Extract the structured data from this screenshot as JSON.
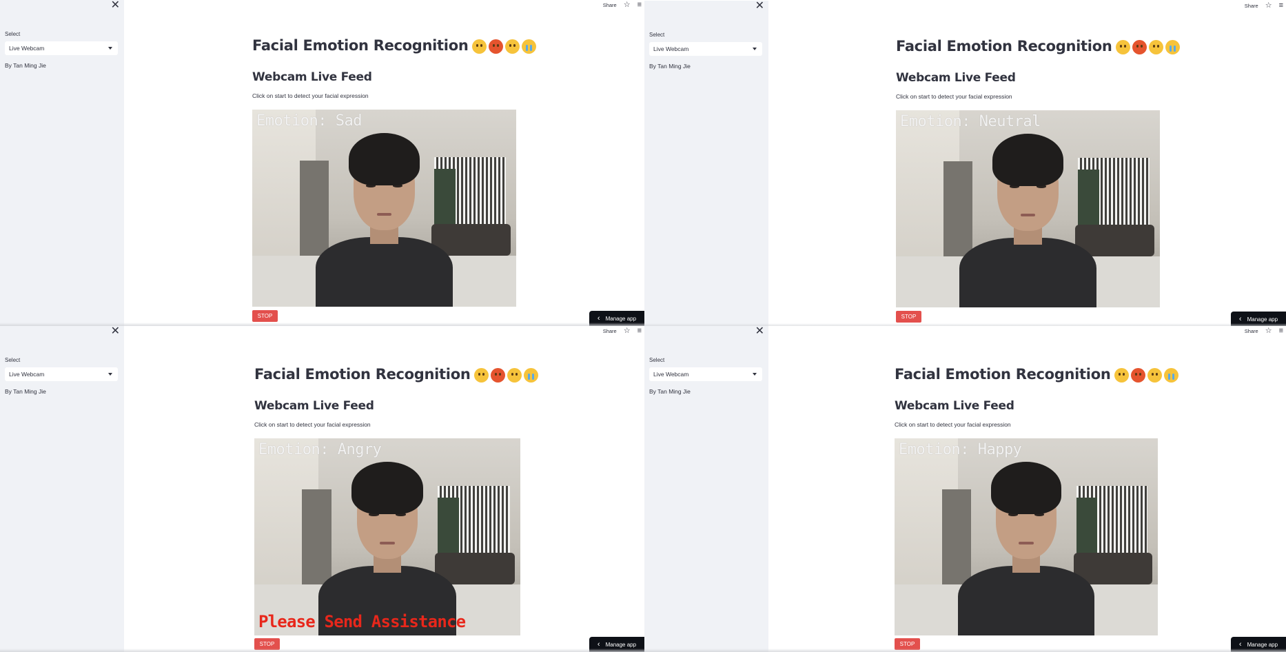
{
  "colors": {
    "sidebar_bg": "#f0f2f6",
    "text": "#31333f",
    "stop_button": "#e3504d",
    "manage_app_bg": "#0e1117",
    "alert_text": "#e8271b"
  },
  "panels": [
    {
      "sidebar": {
        "select_label": "Select",
        "select_value": "Live Webcam",
        "author": "By Tan Ming Jie",
        "close_icon": "✕"
      },
      "topbar": {
        "share_label": "Share",
        "star_icon": "☆",
        "menu_icon": "≡"
      },
      "title": "Facial Emotion Recognition",
      "title_emojis": [
        "happy-emoji",
        "angry-emoji",
        "neutral-emoji",
        "crying-emoji"
      ],
      "subheader": "Webcam Live Feed",
      "caption": "Click on start to detect your facial expression",
      "video": {
        "emotion_text": "Emotion: Sad",
        "alert_text": ""
      },
      "stop_button": "STOP",
      "manage_app": "Manage app"
    },
    {
      "sidebar": {
        "select_label": "Select",
        "select_value": "Live Webcam",
        "author": "By Tan Ming Jie",
        "close_icon": "✕"
      },
      "topbar": {
        "share_label": "Share",
        "star_icon": "☆",
        "menu_icon": "≡"
      },
      "title": "Facial Emotion Recognition",
      "title_emojis": [
        "happy-emoji",
        "angry-emoji",
        "neutral-emoji",
        "crying-emoji"
      ],
      "subheader": "Webcam Live Feed",
      "caption": "Click on start to detect your facial expression",
      "video": {
        "emotion_text": "Emotion: Neutral",
        "alert_text": ""
      },
      "stop_button": "STOP",
      "manage_app": "Manage app"
    },
    {
      "sidebar": {
        "select_label": "Select",
        "select_value": "Live Webcam",
        "author": "By Tan Ming Jie",
        "close_icon": "✕"
      },
      "topbar": {
        "share_label": "Share",
        "star_icon": "☆",
        "menu_icon": "≡"
      },
      "title": "Facial Emotion Recognition",
      "title_emojis": [
        "happy-emoji",
        "angry-emoji",
        "neutral-emoji",
        "crying-emoji"
      ],
      "subheader": "Webcam Live Feed",
      "caption": "Click on start to detect your facial expression",
      "video": {
        "emotion_text": "Emotion: Angry",
        "alert_text": "Please Send Assistance"
      },
      "stop_button": "STOP",
      "manage_app": "Manage app"
    },
    {
      "sidebar": {
        "select_label": "Select",
        "select_value": "Live Webcam",
        "author": "By Tan Ming Jie",
        "close_icon": "✕"
      },
      "topbar": {
        "share_label": "Share",
        "star_icon": "☆",
        "menu_icon": "≡"
      },
      "title": "Facial Emotion Recognition",
      "title_emojis": [
        "happy-emoji",
        "angry-emoji",
        "neutral-emoji",
        "crying-emoji"
      ],
      "subheader": "Webcam Live Feed",
      "caption": "Click on start to detect your facial expression",
      "video": {
        "emotion_text": "Emotion: Happy",
        "alert_text": ""
      },
      "stop_button": "STOP",
      "manage_app": "Manage app"
    }
  ]
}
